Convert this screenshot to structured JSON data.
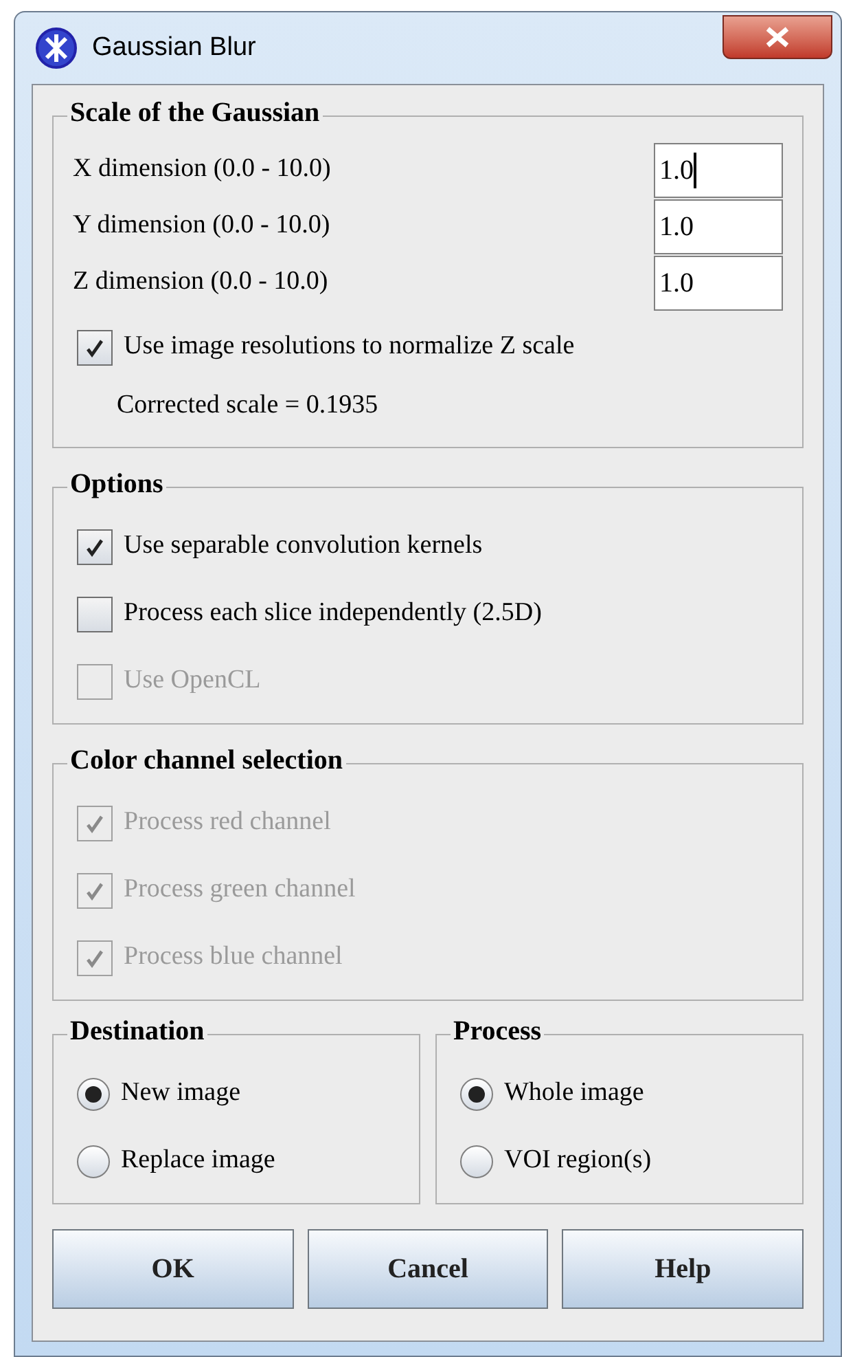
{
  "window": {
    "title": "Gaussian Blur"
  },
  "scale": {
    "title": "Scale of the Gaussian",
    "fields": [
      {
        "label": "X dimension (0.0 - 10.0)",
        "value": "1.0",
        "focused": true
      },
      {
        "label": "Y dimension (0.0 - 10.0)",
        "value": "1.0",
        "focused": false
      },
      {
        "label": "Z dimension (0.0 - 10.0)",
        "value": "1.0",
        "focused": false
      }
    ],
    "checkbox": {
      "label": "Use image resolutions to normalize Z scale",
      "checked": true,
      "disabled": false
    },
    "note": "Corrected scale = 0.1935"
  },
  "options": {
    "title": "Options",
    "checkboxes": [
      {
        "label": "Use separable convolution kernels",
        "checked": true,
        "disabled": false
      },
      {
        "label": "Process each slice independently (2.5D)",
        "checked": false,
        "disabled": false
      },
      {
        "label": "Use OpenCL",
        "checked": false,
        "disabled": true
      }
    ]
  },
  "color": {
    "title": "Color channel selection",
    "checkboxes": [
      {
        "label": "Process red channel",
        "checked": true,
        "disabled": true
      },
      {
        "label": "Process green channel",
        "checked": true,
        "disabled": true
      },
      {
        "label": "Process blue channel",
        "checked": true,
        "disabled": true
      }
    ]
  },
  "destination": {
    "title": "Destination",
    "radios": [
      {
        "label": "New image",
        "selected": true
      },
      {
        "label": "Replace image",
        "selected": false
      }
    ]
  },
  "process": {
    "title": "Process",
    "radios": [
      {
        "label": "Whole image",
        "selected": true
      },
      {
        "label": "VOI region(s)",
        "selected": false
      }
    ]
  },
  "buttons": [
    "OK",
    "Cancel",
    "Help"
  ]
}
